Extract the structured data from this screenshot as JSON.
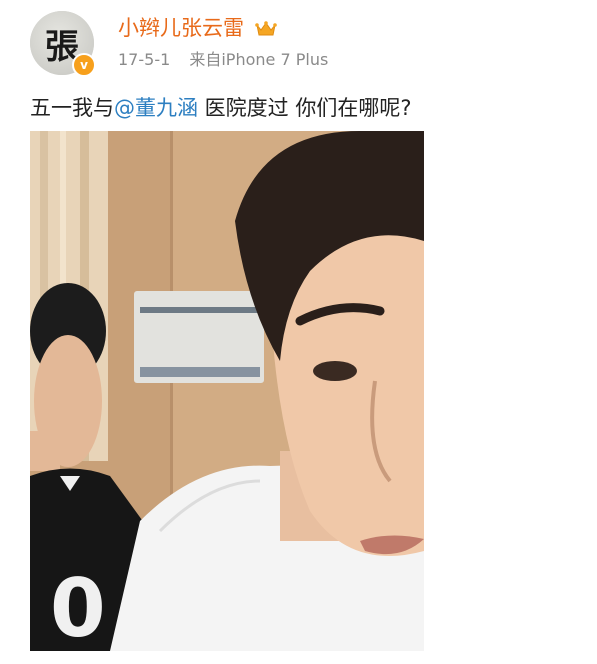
{
  "user": {
    "avatar_glyph": "張",
    "verified_mark": "v",
    "name": "小辫儿张云雷",
    "crown_icon": "crown-icon"
  },
  "meta": {
    "date": "17-5-1",
    "source": "来自iPhone 7 Plus"
  },
  "post": {
    "text_before": "五一我与",
    "mention": "@董九涵",
    "text_after": " 医院度过 你们在哪呢?"
  },
  "photo": {
    "shirt_text": "0"
  },
  "colors": {
    "username": "#e86a1a",
    "mention": "#2d7fc1",
    "meta": "#8a8a8a",
    "verified": "#f7a01c"
  }
}
